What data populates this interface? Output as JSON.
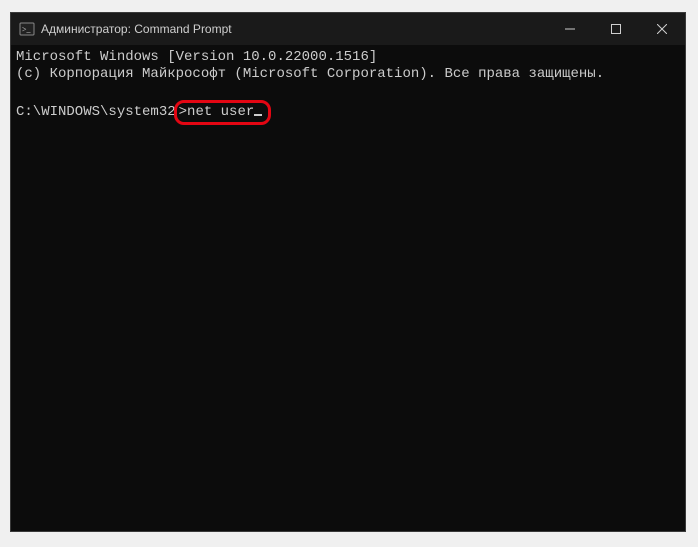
{
  "window": {
    "title": "Администратор: Command Prompt"
  },
  "terminal": {
    "line1": "Microsoft Windows [Version 10.0.22000.1516]",
    "line2": "(c) Корпорация Майкрософт (Microsoft Corporation). Все права защищены.",
    "blank": "",
    "prompt_path": "C:\\WINDOWS\\system32",
    "prompt_char": ">",
    "command": "net user"
  }
}
